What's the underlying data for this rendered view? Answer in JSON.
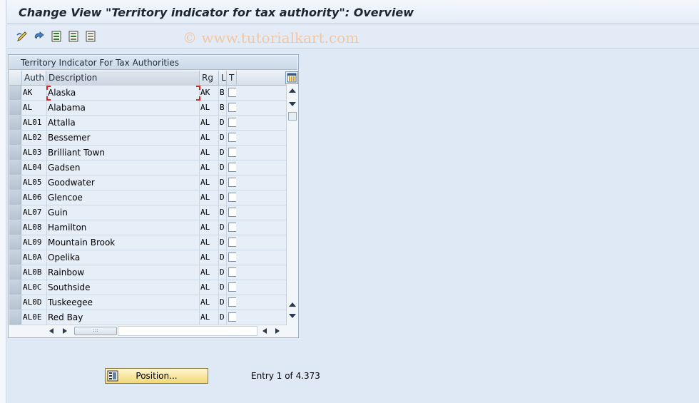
{
  "window": {
    "title": "Change View \"Territory indicator for tax authority\": Overview",
    "watermark": "© www.tutorialkart.com"
  },
  "toolbar": {
    "icons": [
      "display-change-icon",
      "other-view-icon",
      "select-all-icon",
      "select-block-icon",
      "deselect-all-icon"
    ]
  },
  "table": {
    "title": "Territory Indicator For Tax Authorities",
    "columns": {
      "auth": "Auth",
      "description": "Description",
      "rg": "Rg",
      "l": "L",
      "t": "T"
    },
    "rows": [
      {
        "auth": "AK",
        "description": "Alaska",
        "rg": "AK",
        "l": "B",
        "t": false
      },
      {
        "auth": "AL",
        "description": "Alabama",
        "rg": "AL",
        "l": "B",
        "t": false
      },
      {
        "auth": "AL01",
        "description": "Attalla",
        "rg": "AL",
        "l": "D",
        "t": false
      },
      {
        "auth": "AL02",
        "description": "Bessemer",
        "rg": "AL",
        "l": "D",
        "t": false
      },
      {
        "auth": "AL03",
        "description": "Brilliant Town",
        "rg": "AL",
        "l": "D",
        "t": false
      },
      {
        "auth": "AL04",
        "description": "Gadsen",
        "rg": "AL",
        "l": "D",
        "t": false
      },
      {
        "auth": "AL05",
        "description": "Goodwater",
        "rg": "AL",
        "l": "D",
        "t": false
      },
      {
        "auth": "AL06",
        "description": "Glencoe",
        "rg": "AL",
        "l": "D",
        "t": false
      },
      {
        "auth": "AL07",
        "description": "Guin",
        "rg": "AL",
        "l": "D",
        "t": false
      },
      {
        "auth": "AL08",
        "description": "Hamilton",
        "rg": "AL",
        "l": "D",
        "t": false
      },
      {
        "auth": "AL09",
        "description": "Mountain Brook",
        "rg": "AL",
        "l": "D",
        "t": false
      },
      {
        "auth": "AL0A",
        "description": "Opelika",
        "rg": "AL",
        "l": "D",
        "t": false
      },
      {
        "auth": "AL0B",
        "description": "Rainbow",
        "rg": "AL",
        "l": "D",
        "t": false
      },
      {
        "auth": "AL0C",
        "description": "Southside",
        "rg": "AL",
        "l": "D",
        "t": false
      },
      {
        "auth": "AL0D",
        "description": "Tuskeegee",
        "rg": "AL",
        "l": "D",
        "t": false
      },
      {
        "auth": "AL0E",
        "description": "Red Bay",
        "rg": "AL",
        "l": "D",
        "t": false
      }
    ]
  },
  "footer": {
    "position_button": "Position...",
    "entry_info": "Entry 1 of 4.373"
  },
  "colors": {
    "background": "#dfe9f5",
    "button_yellow": "#f0d878",
    "focus_red": "#d22222"
  }
}
